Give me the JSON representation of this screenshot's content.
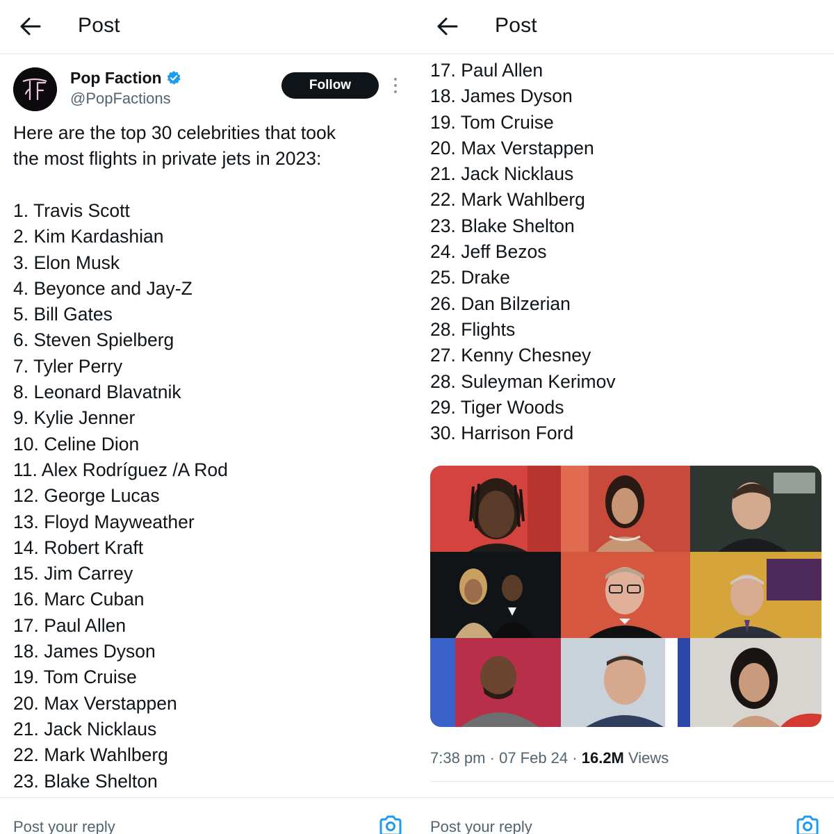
{
  "left": {
    "header": {
      "title": "Post"
    },
    "author": {
      "name": "Pop Faction",
      "handle": "@PopFactions",
      "follow_label": "Follow"
    },
    "intro": [
      "Here are the top 30 celebrities that took",
      "the most flights in private jets in 2023:"
    ],
    "items": [
      "1. Travis Scott",
      "2. Kim Kardashian",
      "3. Elon Musk",
      "4. Beyonce and Jay-Z",
      "5. Bill Gates",
      "6. Steven Spielberg",
      "7. Tyler Perry",
      "8. Leonard Blavatnik",
      "9. Kylie Jenner",
      "10. Celine Dion",
      "11. Alex Rodríguez /A Rod",
      "12. George Lucas",
      "13. Floyd Mayweather",
      "14. Robert Kraft",
      "15. Jim Carrey",
      "16. Marc Cuban",
      "17. Paul Allen",
      "18. James Dyson",
      "19. Tom Cruise",
      "20. Max Verstappen",
      "21. Jack Nicklaus",
      "22. Mark Wahlberg",
      "23. Blake Shelton"
    ],
    "reply_placeholder": "Post your reply"
  },
  "right": {
    "header": {
      "title": "Post"
    },
    "items": [
      "17. Paul Allen",
      "18. James Dyson",
      "19. Tom Cruise",
      "20. Max Verstappen",
      "21. Jack Nicklaus",
      "22. Mark Wahlberg",
      "23. Blake Shelton",
      "24. Jeff Bezos",
      "25. Drake",
      "26. Dan Bilzerian",
      "28. Flights",
      "27. Kenny Chesney",
      "28. Suleyman Kerimov",
      "29. Tiger Woods",
      "30. Harrison Ford"
    ],
    "meta": {
      "time": "7:38 pm",
      "separator": "·",
      "date": "07 Feb 24",
      "views_count": "16.2M",
      "views_label": "Views"
    },
    "reply_placeholder": "Post your reply"
  },
  "colors": {
    "text": "#0f1419",
    "muted": "#536471",
    "verified": "#1d9bf0",
    "follow_bg": "#0f1419",
    "border": "#e6e9ec"
  },
  "icons": {
    "back": "arrow-left-icon",
    "verified": "verified-badge-icon",
    "more": "more-vertical-icon",
    "camera": "camera-icon"
  }
}
